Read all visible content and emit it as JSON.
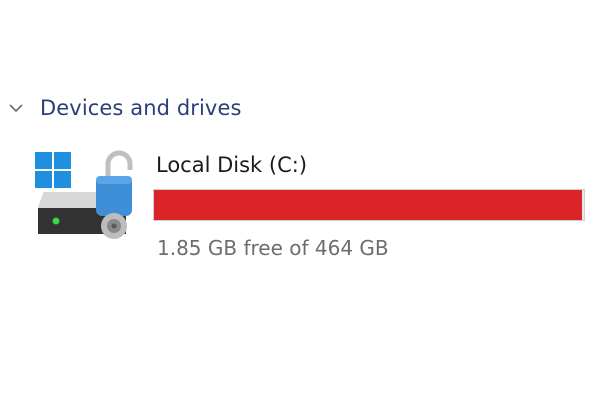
{
  "devices_section": {
    "chevron_icon": "chevron-down-icon",
    "title": "Devices and drives"
  },
  "drives": [
    {
      "icon": "locked-drive-icon",
      "name": "Local Disk (C:)",
      "used_fraction": 0.996,
      "bar_color": "#da2427",
      "free_text": "1.85 GB free of 464 GB"
    }
  ],
  "colors": {
    "section_title": "#2a3f77",
    "usage_critical": "#da2427",
    "windows_logo": "#1f8fe0",
    "padlock": "#3e8ed8",
    "disk_led": "#3cd64a"
  }
}
